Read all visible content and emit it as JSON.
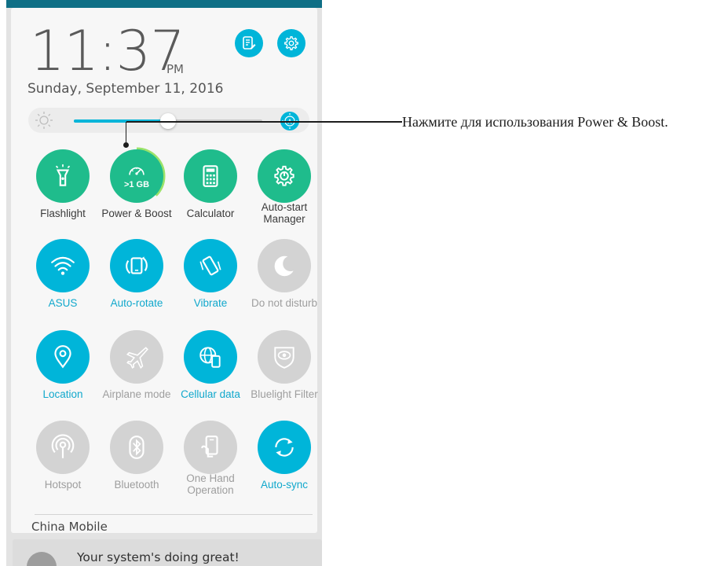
{
  "status": {
    "time": "11:37",
    "ampm": "PM",
    "date": "Sunday, September 11, 2016"
  },
  "header_buttons": [
    {
      "icon": "notes-edit-icon",
      "label": ""
    },
    {
      "icon": "gear-icon",
      "label": ""
    }
  ],
  "brightness": {
    "level": 0.5,
    "auto_icon": "auto-brightness-icon"
  },
  "tiles": [
    {
      "label": "Flashlight",
      "icon": "flashlight-icon",
      "state": "on",
      "color": "#1fbc8c"
    },
    {
      "label": "Power & Boost",
      "icon": "speedometer-icon",
      "state": "on",
      "color": "#1fbc8c",
      "sublabel": ">1 GB"
    },
    {
      "label": "Calculator",
      "icon": "calculator-icon",
      "state": "on",
      "color": "#1fbc8c"
    },
    {
      "label": "Auto-start Manager",
      "icon": "gear-power-icon",
      "state": "on",
      "color": "#1fbc8c"
    },
    {
      "label": "ASUS",
      "icon": "wifi-icon",
      "state": "on",
      "color": "#00b5d9"
    },
    {
      "label": "Auto-rotate",
      "icon": "rotate-icon",
      "state": "on",
      "color": "#00b5d9"
    },
    {
      "label": "Vibrate",
      "icon": "vibrate-icon",
      "state": "on",
      "color": "#00b5d9"
    },
    {
      "label": "Do not disturb",
      "icon": "moon-icon",
      "state": "off",
      "color": "#d3d3d3"
    },
    {
      "label": "Location",
      "icon": "location-pin-icon",
      "state": "on",
      "color": "#00b5d9"
    },
    {
      "label": "Airplane mode",
      "icon": "airplane-icon",
      "state": "off",
      "color": "#d3d3d3"
    },
    {
      "label": "Cellular data",
      "icon": "cellular-globe-icon",
      "state": "on",
      "color": "#00b5d9"
    },
    {
      "label": "Bluelight Filter",
      "icon": "eye-shield-icon",
      "state": "off",
      "color": "#d3d3d3"
    },
    {
      "label": "Hotspot",
      "icon": "hotspot-icon",
      "state": "off",
      "color": "#d3d3d3"
    },
    {
      "label": "Bluetooth",
      "icon": "bluetooth-icon",
      "state": "off",
      "color": "#d3d3d3"
    },
    {
      "label": "One Hand Operation",
      "icon": "one-hand-icon",
      "state": "off",
      "color": "#d3d3d3"
    },
    {
      "label": "Auto-sync",
      "icon": "sync-icon",
      "state": "on",
      "color": "#00b5d9"
    }
  ],
  "carrier": "China Mobile",
  "notification": {
    "text": "Your system's doing great!"
  },
  "callout": {
    "text": "Нажмите для использования Power & Boost."
  }
}
